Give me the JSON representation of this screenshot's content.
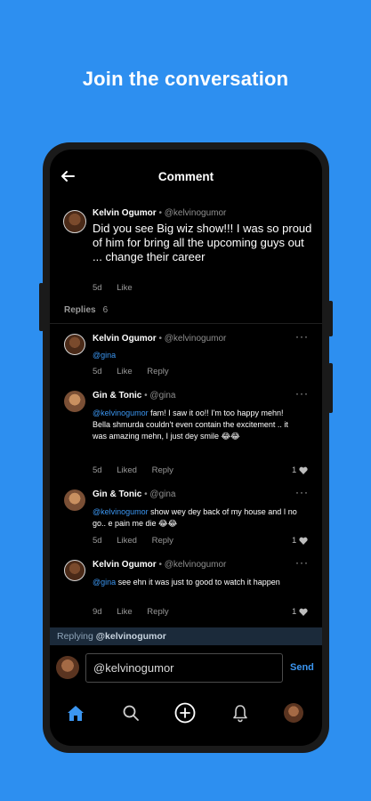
{
  "headline": "Join the conversation",
  "header": {
    "title": "Comment",
    "back_icon": "arrow-left-icon"
  },
  "main_comment": {
    "name": "Kelvin Ogumor",
    "handle": "• @kelvinogumor",
    "text": "Did you see Big wiz show!!! I was so proud of him for bring all the upcoming guys out ... change their career",
    "time": "5d",
    "like_label": "Like"
  },
  "replies_header": {
    "label": "Replies",
    "count": "6"
  },
  "replies": [
    {
      "name": "Kelvin Ogumor",
      "handle": "• @kelvinogumor",
      "mention": "@gina",
      "text": "",
      "time": "5d",
      "like_label": "Like",
      "reply_label": "Reply",
      "likes": ""
    },
    {
      "name": "Gin & Tonic",
      "handle": "• @gina",
      "mention": "@kelvinogumor",
      "text": " fam! I saw it oo!! I'm too happy mehn! Bella shmurda couldn't even contain the excitement .. it was amazing mehn, I just dey smile 😂😂",
      "time": "5d",
      "like_label": "Liked",
      "reply_label": "Reply",
      "likes": "1"
    },
    {
      "name": "Gin & Tonic",
      "handle": "• @gina",
      "mention": "@kelvinogumor",
      "text": " show wey dey back of my house and I no go.. e pain me die 😂😂",
      "time": "5d",
      "like_label": "Liked",
      "reply_label": "Reply",
      "likes": "1"
    },
    {
      "name": "Kelvin Ogumor",
      "handle": "• @kelvinogumor",
      "mention": "@gina",
      "text": " see ehn it was just to good to watch it happen",
      "time": "9d",
      "like_label": "Like",
      "reply_label": "Reply",
      "likes": "1"
    }
  ],
  "replying": {
    "label": "Replying",
    "handle": "@kelvinogumor"
  },
  "composer": {
    "value": "@kelvinogumor",
    "send_label": "Send"
  },
  "nav": {
    "icons": [
      "home-icon",
      "search-icon",
      "plus-circle-icon",
      "bell-icon",
      "profile-avatar"
    ]
  },
  "colors": {
    "background": "#2d8ff0",
    "accent": "#3b96f1",
    "screen": "#000000"
  }
}
